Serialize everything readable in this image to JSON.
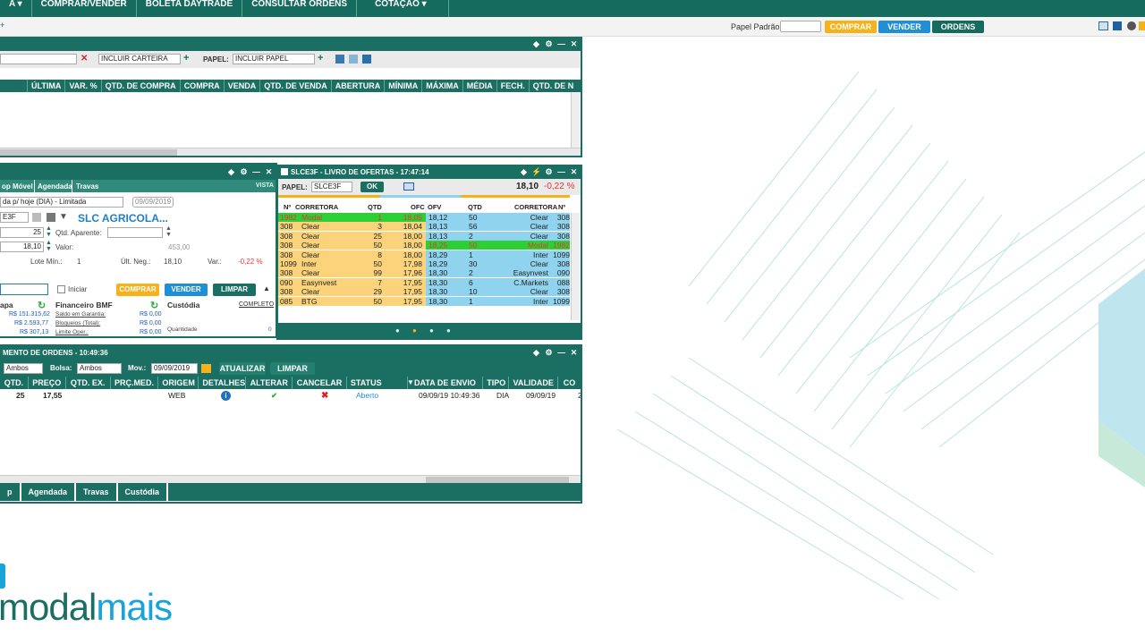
{
  "nav": {
    "menu": [
      "A ▾",
      "COMPRAR/VENDER",
      "BOLETA DAYTRADE",
      "CONSULTAR ORDENS",
      "COTAÇÃO ▾"
    ]
  },
  "toolbar": {
    "papel_label": "Papel Padrão:",
    "buy": "COMPRAR",
    "sell": "VENDER",
    "orders": "ORDENS"
  },
  "watchlist": {
    "include_wallet": "INCLUIR CARTEIRA",
    "papel_label": "PAPEL:",
    "include_paper": "INCLUIR PAPEL",
    "columns": [
      "ÚLTIMA",
      "VAR. %",
      "QTD. DE COMPRA",
      "COMPRA",
      "VENDA",
      "QTD. DE VENDA",
      "ABERTURA",
      "MÍNIMA",
      "MÁXIMA",
      "MÉDIA",
      "FECH.",
      "QTD. DE N"
    ]
  },
  "boleta": {
    "tabs": [
      "op Móvel",
      "Agendada",
      "Travas"
    ],
    "vista": "VISTA",
    "validity": "da p/ hoje (DIA) - Limitada",
    "date": "09/09/2019",
    "ticker": "E3F",
    "company": "SLC AGRICOLA...",
    "qty": "25",
    "qtd_aparente": "Qtd. Aparente:",
    "price": "18,10",
    "valor_label": "Valor:",
    "valor": "453,00",
    "lote_label": "Lote Mín.:",
    "lote": "1",
    "ult_label": "Últ. Neg.:",
    "ult": "18,10",
    "var_label": "Var.:",
    "var": "-0,22 %",
    "iniciar": "Iniciar",
    "buy": "COMPRAR",
    "sell": "VENDER",
    "clear": "LIMPAR",
    "bovespa_title": "apa",
    "bovespa_values": [
      "R$ 151.315,62",
      "R$ 2.593,77",
      "R$ 307,13"
    ],
    "bmf_title": "Financeiro BMF",
    "bmf_labels": [
      "Saldo em Garantia:",
      "Bloqueios (Total):",
      "Limite Oper.:"
    ],
    "bmf_values": [
      "R$ 0,00",
      "R$ 0,00",
      "R$ 0,00"
    ],
    "custodia_title": "Custódia",
    "completo": "COMPLETO",
    "quantidade_label": "Quantidade",
    "quantidade": "0"
  },
  "book": {
    "title": "SLCE3F - LIVRO DE OFERTAS - 17:47:14",
    "papel_label": "PAPEL:",
    "papel": "SLCE3F",
    "ok": "OK",
    "last": "18,10",
    "var": "-0,22 %",
    "headers": [
      "Nº",
      "CORRETORA",
      "QTD",
      "OFC",
      "OFV",
      "QTD",
      "CORRETORA",
      "Nº"
    ],
    "rows": [
      {
        "bn": "1982",
        "bb": "Modal",
        "bq": "1",
        "bp": "18,05",
        "ap": "18,12",
        "aq": "50",
        "ab": "Clear",
        "an": "308",
        "bh": true,
        "ah": false
      },
      {
        "bn": "308",
        "bb": "Clear",
        "bq": "3",
        "bp": "18,04",
        "ap": "18,13",
        "aq": "56",
        "ab": "Clear",
        "an": "308",
        "bh": false,
        "ah": false
      },
      {
        "bn": "308",
        "bb": "Clear",
        "bq": "25",
        "bp": "18,00",
        "ap": "18,13",
        "aq": "2",
        "ab": "Clear",
        "an": "308",
        "bh": false,
        "ah": false
      },
      {
        "bn": "308",
        "bb": "Clear",
        "bq": "50",
        "bp": "18,00",
        "ap": "18,25",
        "aq": "50",
        "ab": "Modal",
        "an": "1982",
        "bh": false,
        "ah": true
      },
      {
        "bn": "308",
        "bb": "Clear",
        "bq": "8",
        "bp": "18,00",
        "ap": "18,29",
        "aq": "1",
        "ab": "Inter",
        "an": "1099",
        "bh": false,
        "ah": false
      },
      {
        "bn": "1099",
        "bb": "Inter",
        "bq": "50",
        "bp": "17,98",
        "ap": "18,29",
        "aq": "30",
        "ab": "Clear",
        "an": "308",
        "bh": false,
        "ah": false
      },
      {
        "bn": "308",
        "bb": "Clear",
        "bq": "99",
        "bp": "17,96",
        "ap": "18,30",
        "aq": "2",
        "ab": "Easynvest",
        "an": "090",
        "bh": false,
        "ah": false
      },
      {
        "bn": "090",
        "bb": "Easynvest",
        "bq": "7",
        "bp": "17,95",
        "ap": "18,30",
        "aq": "6",
        "ab": "C.Markets",
        "an": "088",
        "bh": false,
        "ah": false
      },
      {
        "bn": "308",
        "bb": "Clear",
        "bq": "29",
        "bp": "17,95",
        "ap": "18,30",
        "aq": "10",
        "ab": "Clear",
        "an": "308",
        "bh": false,
        "ah": false
      },
      {
        "bn": "085",
        "bb": "BTG",
        "bq": "50",
        "bp": "17,95",
        "ap": "18,30",
        "aq": "1",
        "ab": "Inter",
        "an": "1099",
        "bh": false,
        "ah": false
      }
    ]
  },
  "orders": {
    "title": "MENTO DE ORDENS - 10:49:36",
    "filter1": "Ambos",
    "bolsa_label": "Bolsa:",
    "bolsa": "Ambos",
    "mov_label": "Mov.:",
    "mov": "09/09/2019",
    "update": "ATUALIZAR",
    "clear": "LIMPAR",
    "columns": [
      "QTD.",
      "PREÇO",
      "QTD. EX.",
      "PRÇ.MED.",
      "ORIGEM",
      "DETALHES",
      "ALTERAR",
      "CANCELAR",
      "STATUS",
      "DATA DE ENVIO",
      "TIPO",
      "VALIDADE",
      "CO"
    ],
    "row": {
      "qtd": "25",
      "preco": "17,55",
      "origem": "WEB",
      "status": "Aberto",
      "data": "09/09/19 10:49:36",
      "tipo": "DIA",
      "validade": "09/09/19",
      "co": "2"
    },
    "tabs": [
      "p",
      "Agendada",
      "Travas",
      "Custódia"
    ]
  },
  "brand": {
    "part1": "modal",
    "part2": "mais"
  },
  "colors": {
    "primary": "#1a6e62",
    "buy": "#f6b21a",
    "sell": "#1f8fd6",
    "bid_row": "#fbd37a",
    "ask_row": "#8fd3ee",
    "highlight": "#2ccf35",
    "brand_green": "#1a6e62",
    "brand_blue": "#1aa3d9"
  }
}
